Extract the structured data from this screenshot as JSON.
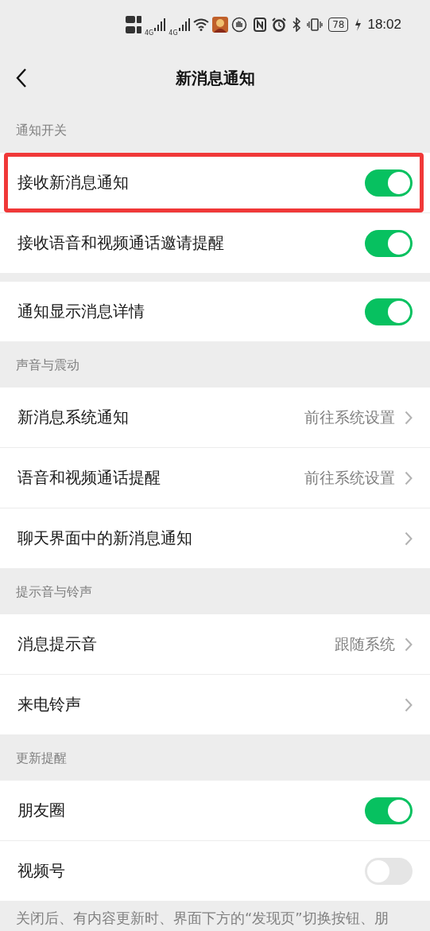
{
  "status_bar": {
    "network_1": "4G",
    "network_2": "4G",
    "battery": "78",
    "time": "18:02"
  },
  "nav": {
    "title": "新消息通知"
  },
  "groups": [
    {
      "title": "通知开关",
      "rows": [
        {
          "kind": "toggle",
          "label": "接收新消息通知",
          "on": true,
          "highlighted": true
        },
        {
          "kind": "toggle",
          "label": "接收语音和视频通话邀请提醒",
          "on": true,
          "highlighted": false
        }
      ]
    },
    {
      "rows": [
        {
          "kind": "toggle",
          "label": "通知显示消息详情",
          "on": true,
          "highlighted": false
        }
      ]
    },
    {
      "title": "声音与震动",
      "rows": [
        {
          "kind": "link",
          "label": "新消息系统通知",
          "value": "前往系统设置",
          "highlighted": false
        },
        {
          "kind": "link",
          "label": "语音和视频通话提醒",
          "value": "前往系统设置",
          "highlighted": false
        },
        {
          "kind": "link",
          "label": "聊天界面中的新消息通知",
          "highlighted": false
        }
      ]
    },
    {
      "title": "提示音与铃声",
      "rows": [
        {
          "kind": "link",
          "label": "消息提示音",
          "value": "跟随系统",
          "highlighted": false
        },
        {
          "kind": "link",
          "label": "来电铃声",
          "highlighted": false
        }
      ]
    },
    {
      "title": "更新提醒",
      "rows": [
        {
          "kind": "toggle",
          "label": "朋友圈",
          "on": true,
          "highlighted": false
        },
        {
          "kind": "toggle",
          "label": "视频号",
          "on": false,
          "highlighted": false
        }
      ]
    }
  ],
  "footer_note": "关闭后、有内容更新时、界面下方的“发现页”切换按钮、朋"
}
